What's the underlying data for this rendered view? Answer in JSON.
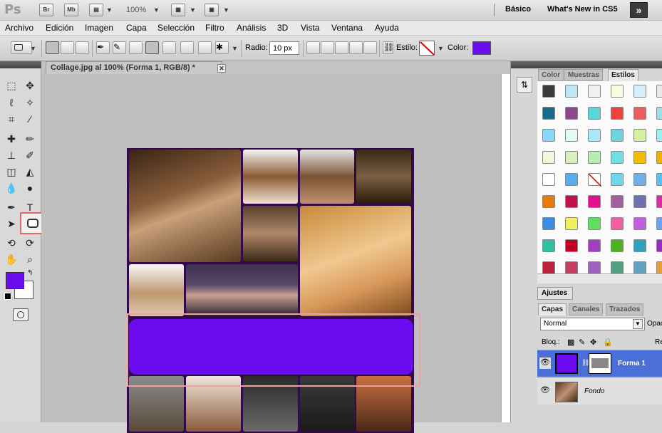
{
  "app": {
    "logo": "Ps",
    "bridge": "Br",
    "minibridge": "Mb",
    "zoom": "100%",
    "workspace_basico": "Básico",
    "workspace_new": "What's New in CS5",
    "more": "»"
  },
  "menu": [
    "Archivo",
    "Edición",
    "Imagen",
    "Capa",
    "Selección",
    "Filtro",
    "Análisis",
    "3D",
    "Vista",
    "Ventana",
    "Ayuda"
  ],
  "options": {
    "radio_label": "Radio:",
    "radio_value": "10 px",
    "estilo_label": "Estilo:",
    "color_label": "Color:",
    "shape_color": "#6b0cf0"
  },
  "toolbox": {
    "foreground_color": "#6b0cf0",
    "background_color": "#ffffff",
    "type_tool": "T"
  },
  "document": {
    "tab_title": "Collage.jpg al 100% (Forma 1, RGB/8) *",
    "close": "✕",
    "collage_border_color": "#320a4a"
  },
  "panels": {
    "tabs": [
      "Color",
      "Muestras",
      "Estilos"
    ],
    "active_tab": "Estilos",
    "ajustes": "Ajustes",
    "layer_tabs": [
      "Capas",
      "Canales",
      "Trazados"
    ],
    "blend_mode": "Normal",
    "opacity_label": "Opac",
    "lock_label": "Bloq.:",
    "fill_label": "Re",
    "layers": [
      {
        "name": "Forma 1",
        "selected": true
      },
      {
        "name": "Fondo",
        "selected": false
      }
    ]
  }
}
